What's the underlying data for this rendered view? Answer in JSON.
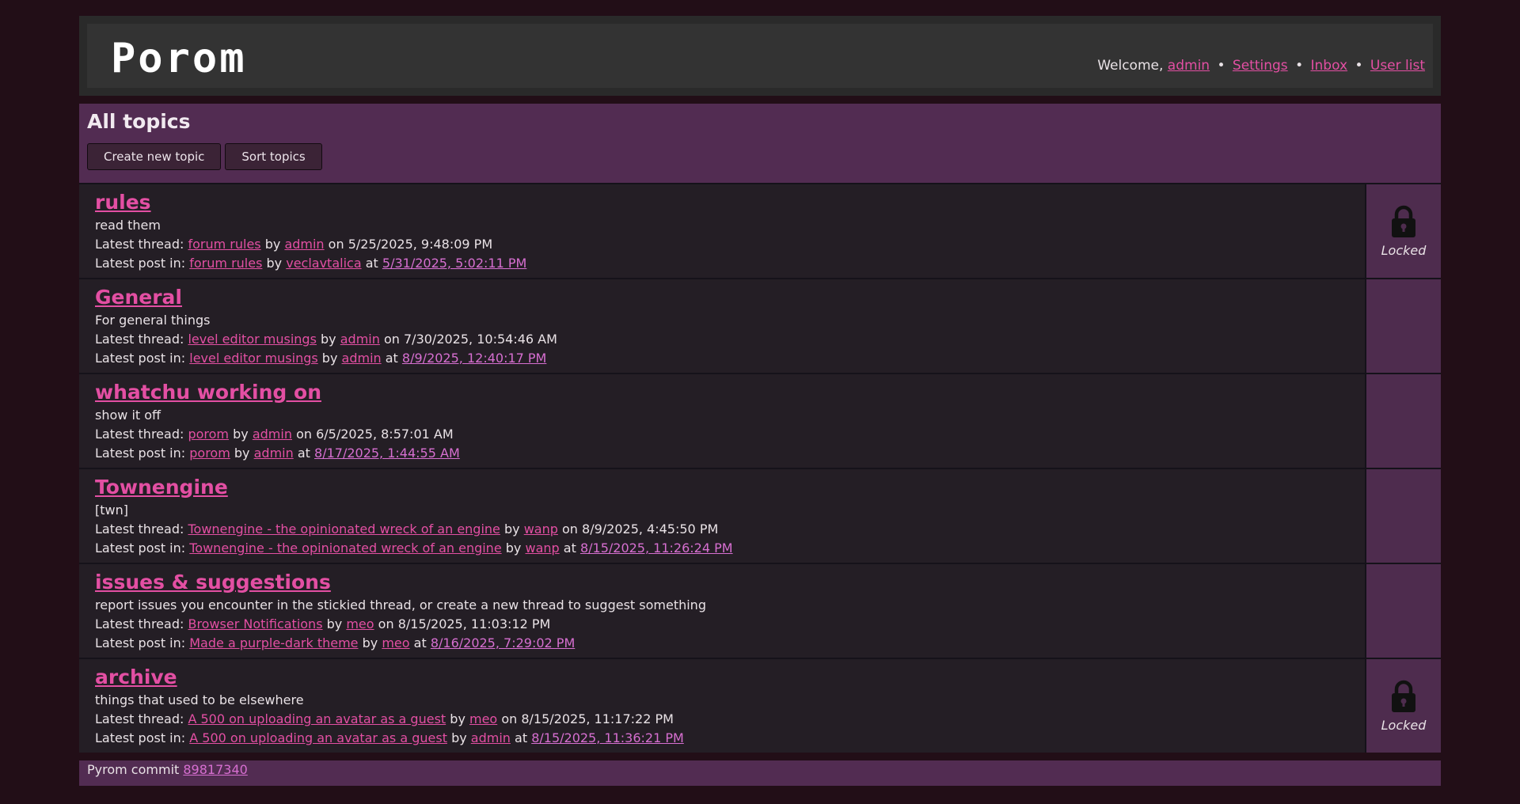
{
  "header": {
    "logo": "Porom",
    "welcome": "Welcome,",
    "user": "admin",
    "links": [
      "Settings",
      "Inbox",
      "User list"
    ]
  },
  "page": {
    "title": "All topics",
    "create_button": "Create new topic",
    "sort_button": "Sort topics"
  },
  "labels": {
    "latest_thread": "Latest thread:",
    "latest_post": "Latest post in:",
    "by": "by",
    "on": "on",
    "at": "at",
    "locked": "Locked"
  },
  "topics": [
    {
      "title": "rules",
      "desc": "read them",
      "locked": true,
      "thread": "forum rules",
      "thread_by": "admin",
      "thread_on": "5/25/2025, 9:48:09 PM",
      "post": "forum rules",
      "post_by": "veclavtalica",
      "post_at": "5/31/2025, 5:02:11 PM"
    },
    {
      "title": "General",
      "desc": "For general things",
      "locked": false,
      "thread": "level editor musings",
      "thread_by": "admin",
      "thread_on": "7/30/2025, 10:54:46 AM",
      "post": "level editor musings",
      "post_by": "admin",
      "post_at": "8/9/2025, 12:40:17 PM"
    },
    {
      "title": "whatchu working on",
      "desc": "show it off",
      "locked": false,
      "thread": "porom",
      "thread_by": "admin",
      "thread_on": "6/5/2025, 8:57:01 AM",
      "post": "porom",
      "post_by": "admin",
      "post_at": "8/17/2025, 1:44:55 AM"
    },
    {
      "title": "Townengine",
      "desc": "[twn]",
      "locked": false,
      "thread": "Townengine - the opinionated wreck of an engine",
      "thread_by": "wanp",
      "thread_on": "8/9/2025, 4:45:50 PM",
      "post": "Townengine - the opinionated wreck of an engine",
      "post_by": "wanp",
      "post_at": "8/15/2025, 11:26:24 PM"
    },
    {
      "title": "issues & suggestions",
      "desc": "report issues you encounter in the stickied thread, or create a new thread to suggest something",
      "locked": false,
      "thread": "Browser Notifications",
      "thread_by": "meo",
      "thread_on": "8/15/2025, 11:03:12 PM",
      "post": "Made a purple-dark theme",
      "post_by": "meo",
      "post_at": "8/16/2025, 7:29:02 PM"
    },
    {
      "title": "archive",
      "desc": "things that used to be elsewhere",
      "locked": true,
      "thread": "A 500 on uploading an avatar as a guest",
      "thread_by": "meo",
      "thread_on": "8/15/2025, 11:17:22 PM",
      "post": "A 500 on uploading an avatar as a guest",
      "post_by": "admin",
      "post_at": "8/15/2025, 11:36:21 PM"
    }
  ],
  "footer": {
    "text": "Pyrom commit",
    "commit": "89817340"
  },
  "icons": {
    "lock": "lock-icon"
  },
  "colors": {
    "link": "#e34fa3",
    "bg": "#220e17",
    "panel": "#522c52"
  }
}
